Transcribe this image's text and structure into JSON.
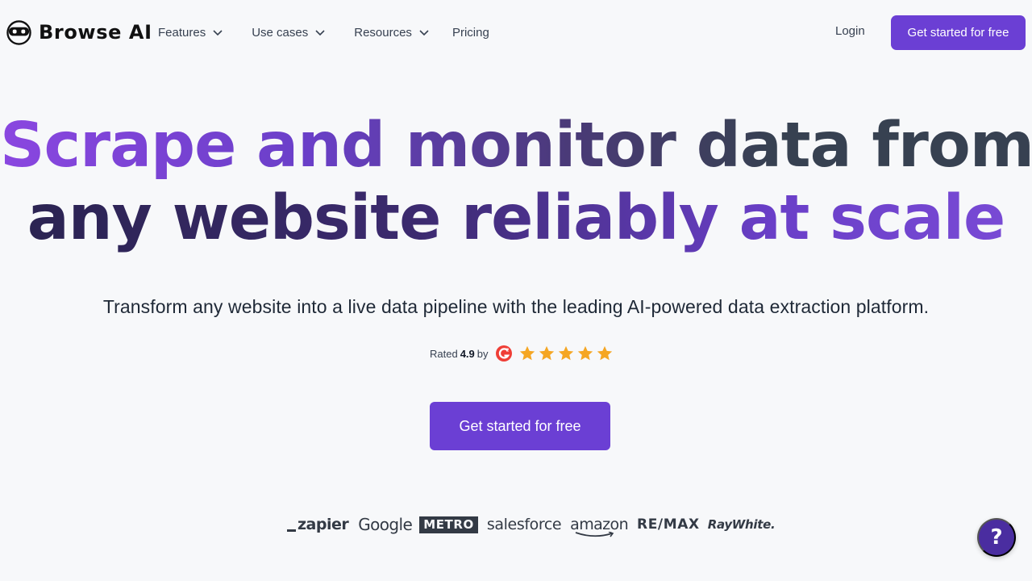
{
  "brand": {
    "name": "Browse AI"
  },
  "nav": {
    "items": [
      {
        "label": "Features",
        "has_dropdown": true
      },
      {
        "label": "Use cases",
        "has_dropdown": true
      },
      {
        "label": "Resources",
        "has_dropdown": true
      },
      {
        "label": "Pricing",
        "has_dropdown": false
      }
    ],
    "login": "Login",
    "cta": "Get started for free"
  },
  "hero": {
    "title_line1": "Scrape and monitor data from",
    "title_line2": "any website reliably at scale",
    "subtitle": "Transform any website into a live data pipeline with the leading AI-powered data extraction platform.",
    "rating": {
      "prefix": "Rated",
      "score": "4.9",
      "by": "by",
      "platform_icon": "g2-logo-icon",
      "stars": 5
    },
    "cta": "Get started for free"
  },
  "brands": [
    {
      "name": "zapier"
    },
    {
      "name": "Google"
    },
    {
      "name": "METRO"
    },
    {
      "name": "salesforce"
    },
    {
      "name": "amazon"
    },
    {
      "name": "RE/MAX"
    },
    {
      "name": "RayWhite."
    }
  ],
  "help": {
    "label": "?"
  },
  "colors": {
    "accent": "#6b3fd4",
    "help": "#4a2da0",
    "star": "#f5a623",
    "g2": "#ef3e36",
    "background": "#f7f8fa"
  }
}
